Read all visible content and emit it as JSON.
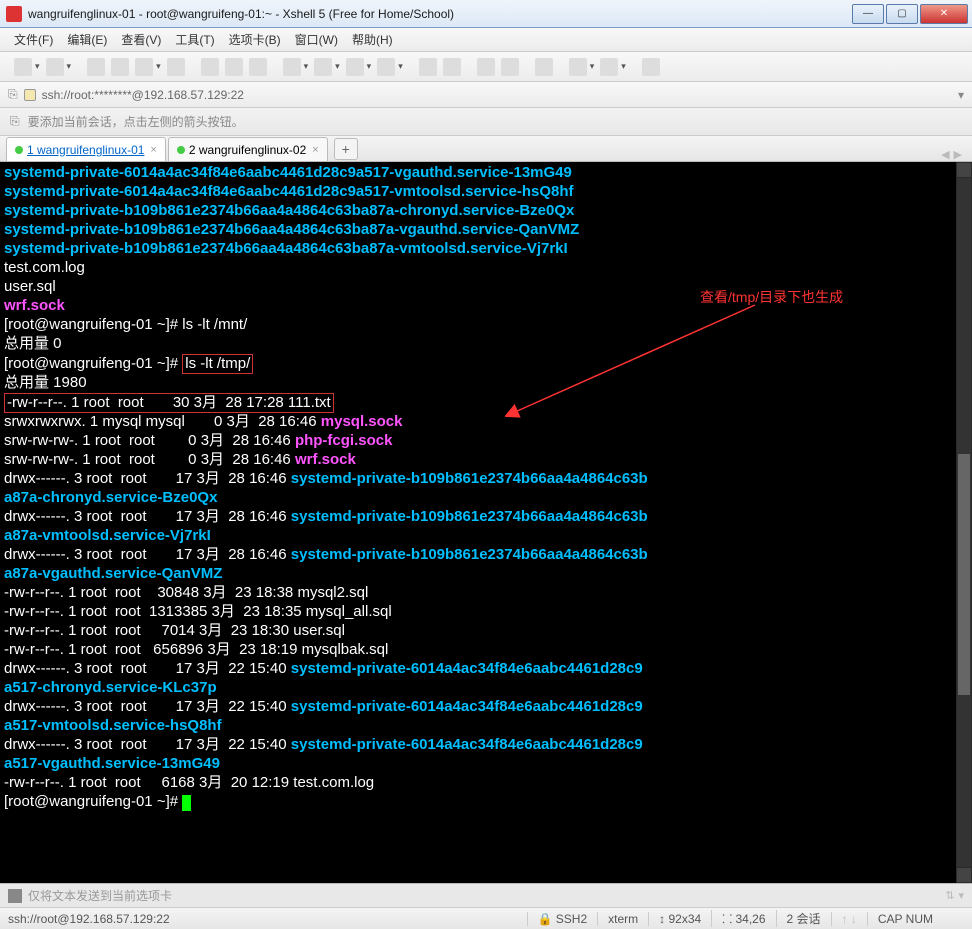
{
  "window": {
    "title": "wangruifenglinux-01 - root@wangruifeng-01:~ - Xshell 5 (Free for Home/School)"
  },
  "menu": {
    "file": "文件(F)",
    "edit": "编辑(E)",
    "view": "查看(V)",
    "tools": "工具(T)",
    "tabs": "选项卡(B)",
    "window": "窗口(W)",
    "help": "帮助(H)"
  },
  "addressbar": "ssh://root:********@192.168.57.129:22",
  "msgbar": "要添加当前会话，点击左侧的箭头按钮。",
  "tabs": {
    "t1": "1 wangruifenglinux-01",
    "t2": "2 wangruifenglinux-02"
  },
  "annotation": "查看/tmp/目录下也生成",
  "term": {
    "l1": "systemd-private-6014a4ac34f84e6aabc4461d28c9a517-vgauthd.service-13mG49",
    "l2": "systemd-private-6014a4ac34f84e6aabc4461d28c9a517-vmtoolsd.service-hsQ8hf",
    "l3": "systemd-private-b109b861e2374b66aa4a4864c63ba87a-chronyd.service-Bze0Qx",
    "l4": "systemd-private-b109b861e2374b66aa4a4864c63ba87a-vgauthd.service-QanVMZ",
    "l5": "systemd-private-b109b861e2374b66aa4a4864c63ba87a-vmtoolsd.service-Vj7rkI",
    "l6": "test.com.log",
    "l7": "user.sql",
    "l8": "wrf.sock",
    "p1": "[root@wangruifeng-01 ~]# ",
    "cmd1": "ls -lt /mnt/",
    "l9": "总用量 0",
    "p2": "[root@wangruifeng-01 ~]# ",
    "cmd2": "ls -lt /tmp/",
    "l10": "总用量 1980",
    "r1a": "-rw-r--r--. 1 root  root       30 3月  28 17:28 ",
    "r1b": "111.txt",
    "r2a": "srwxrwxrwx. 1 mysql mysql       0 3月  28 16:46 ",
    "r2b": "mysql.sock",
    "r3a": "srw-rw-rw-. 1 root  root        0 3月  28 16:46 ",
    "r3b": "php-fcgi.sock",
    "r4a": "srw-rw-rw-. 1 root  root        0 3月  28 16:46 ",
    "r4b": "wrf.sock",
    "r5a": "drwx------. 3 root  root       17 3月  28 16:46 ",
    "r5b": "systemd-private-b109b861e2374b66aa4a4864c63b",
    "r5c": "a87a-chronyd.service-Bze0Qx",
    "r6a": "drwx------. 3 root  root       17 3月  28 16:46 ",
    "r6b": "systemd-private-b109b861e2374b66aa4a4864c63b",
    "r6c": "a87a-vmtoolsd.service-Vj7rkI",
    "r7a": "drwx------. 3 root  root       17 3月  28 16:46 ",
    "r7b": "systemd-private-b109b861e2374b66aa4a4864c63b",
    "r7c": "a87a-vgauthd.service-QanVMZ",
    "r8": "-rw-r--r--. 1 root  root    30848 3月  23 18:38 mysql2.sql",
    "r9": "-rw-r--r--. 1 root  root  1313385 3月  23 18:35 mysql_all.sql",
    "r10": "-rw-r--r--. 1 root  root     7014 3月  23 18:30 user.sql",
    "r11": "-rw-r--r--. 1 root  root   656896 3月  23 18:19 mysqlbak.sql",
    "r12a": "drwx------. 3 root  root       17 3月  22 15:40 ",
    "r12b": "systemd-private-6014a4ac34f84e6aabc4461d28c9",
    "r12c": "a517-chronyd.service-KLc37p",
    "r13a": "drwx------. 3 root  root       17 3月  22 15:40 ",
    "r13b": "systemd-private-6014a4ac34f84e6aabc4461d28c9",
    "r13c": "a517-vmtoolsd.service-hsQ8hf",
    "r14a": "drwx------. 3 root  root       17 3月  22 15:40 ",
    "r14b": "systemd-private-6014a4ac34f84e6aabc4461d28c9",
    "r14c": "a517-vgauthd.service-13mG49",
    "r15": "-rw-r--r--. 1 root  root     6168 3月  20 12:19 test.com.log",
    "p3": "[root@wangruifeng-01 ~]# "
  },
  "inputbar": "仅将文本发送到当前选项卡",
  "status": {
    "left": "ssh://root@192.168.57.129:22",
    "ssh": "SSH2",
    "term": "xterm",
    "size": "92x34",
    "pos": "34,26",
    "sess": "2 会话",
    "caps": "CAP  NUM"
  }
}
